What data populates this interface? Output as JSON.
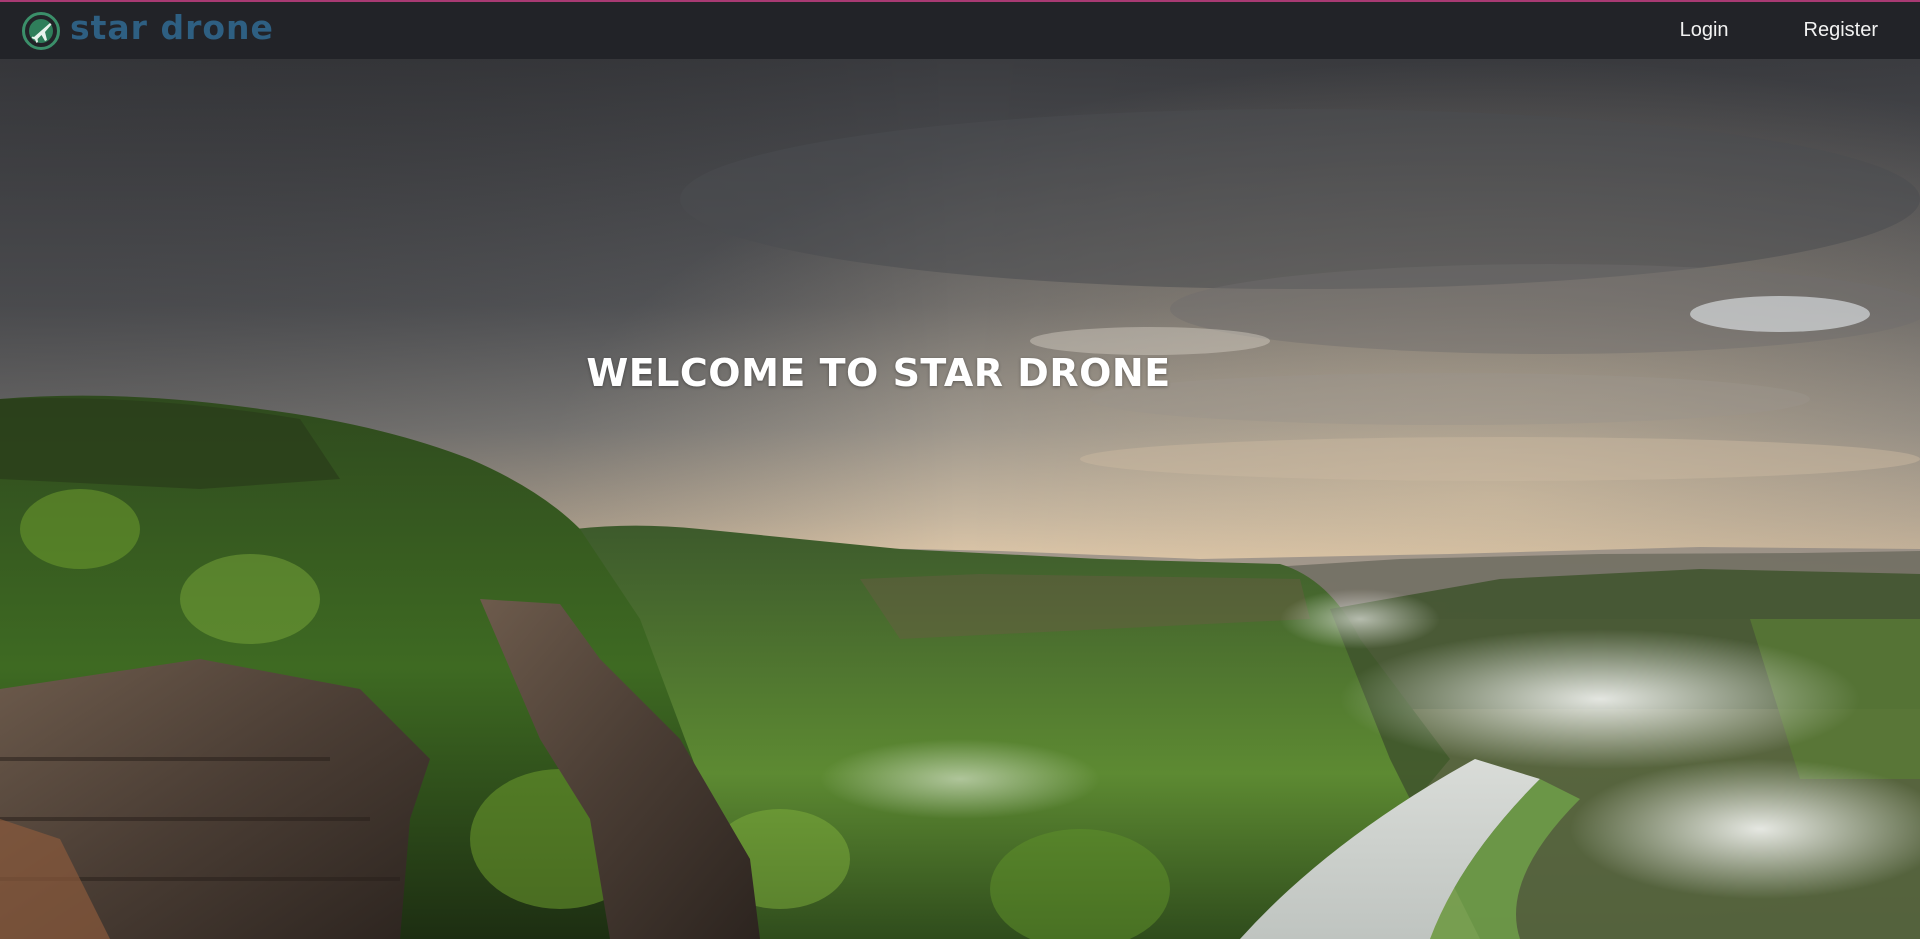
{
  "navbar": {
    "brand_text": "star drone",
    "brand_icon": "airplane-circle-icon",
    "links": [
      {
        "label": "Login"
      },
      {
        "label": "Register"
      }
    ],
    "colors": {
      "background": "#222328",
      "accent_top_border": "#a83a73",
      "brand": "#2e5f82",
      "link": "#f2f2f2"
    }
  },
  "hero": {
    "title": "WELCOME TO STAR DRONE",
    "background_image": "landscape-photo",
    "title_color": "#ffffff"
  }
}
